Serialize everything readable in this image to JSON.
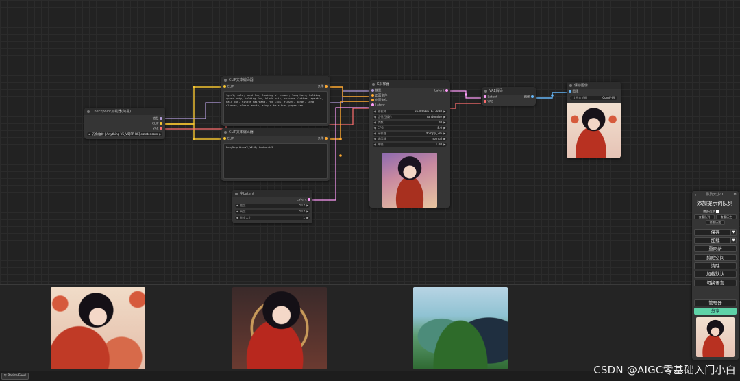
{
  "nodes": {
    "checkpoint": {
      "title": "Checkpoint加载器(简易)",
      "outputs": [
        "模型",
        "CLIP",
        "VAE"
      ],
      "ckpt_label": "Ckpt名称",
      "ckpt_value": "万象熔炉 | Anything V5_V5[PR-RE].safetensors"
    },
    "clip_pos": {
      "title": "CLIP文本编码器",
      "input": "CLIP",
      "output": "条件",
      "text": "1girl, solo, hand fan, looking at viewer, long hair, holding, upper body, holding fan, black hair, chinese clothes, sparkle, hair bun, single hairband, red lips, flower, bangs, long sleeves, closed mouth, single hair bun, paper fan"
    },
    "clip_neg": {
      "title": "CLIP文本编码器",
      "input": "CLIP",
      "output": "条件",
      "text": "EasyNegativeV2_V2.0, badhandv5"
    },
    "ksampler": {
      "title": "K采样器",
      "inputs": [
        "模型",
        "正面条件",
        "负面条件",
        "Latent"
      ],
      "output": "Latent",
      "widgets": [
        {
          "label": "随机种",
          "value": "354899951622830"
        },
        {
          "label": "运行后操作",
          "value": "randomize"
        },
        {
          "label": "步数",
          "value": "20"
        },
        {
          "label": "CFG",
          "value": "8.0"
        },
        {
          "label": "采样器",
          "value": "dpmpp_2m"
        },
        {
          "label": "调度器",
          "value": "normal"
        },
        {
          "label": "降噪",
          "value": "1.00"
        }
      ]
    },
    "vae_decode": {
      "title": "VAE解码",
      "inputs": [
        "Latent",
        "VAE"
      ],
      "output": "图像"
    },
    "save_image": {
      "title": "保存图像",
      "input": "图像",
      "prefix_label": "文件名前缀",
      "prefix_value": "ComfyUI"
    },
    "empty_latent": {
      "title": "空Latent",
      "output": "Latent",
      "widgets": [
        {
          "label": "宽度",
          "value": "512"
        },
        {
          "label": "高度",
          "value": "512"
        },
        {
          "label": "批次大小",
          "value": "1"
        }
      ]
    }
  },
  "queue_menu": {
    "header": "队列大小: 0",
    "queue_prompt": "添加提示词队列",
    "extra_options": "更多选项",
    "view_queue": "查看队列",
    "view_history": "查看历史",
    "save": "保存",
    "load": "加载",
    "refresh": "重刷新",
    "clipspace": "剪贴空间",
    "clear": "清除",
    "load_default": "加载默认",
    "switch_language": "切换语言",
    "manager": "管理器",
    "share": "分享"
  },
  "bottom": {
    "resize_feed": "⇆ Resize Feed"
  },
  "watermark": "CSDN @AIGC零基础入门小白",
  "colors": {
    "model": "#b39ddb",
    "clip": "#f5c430",
    "vae": "#ff6e6e",
    "conditioning": "#ffa931",
    "latent": "#ff9cf9",
    "image": "#64b5f6",
    "share": "#5fd3a8"
  }
}
